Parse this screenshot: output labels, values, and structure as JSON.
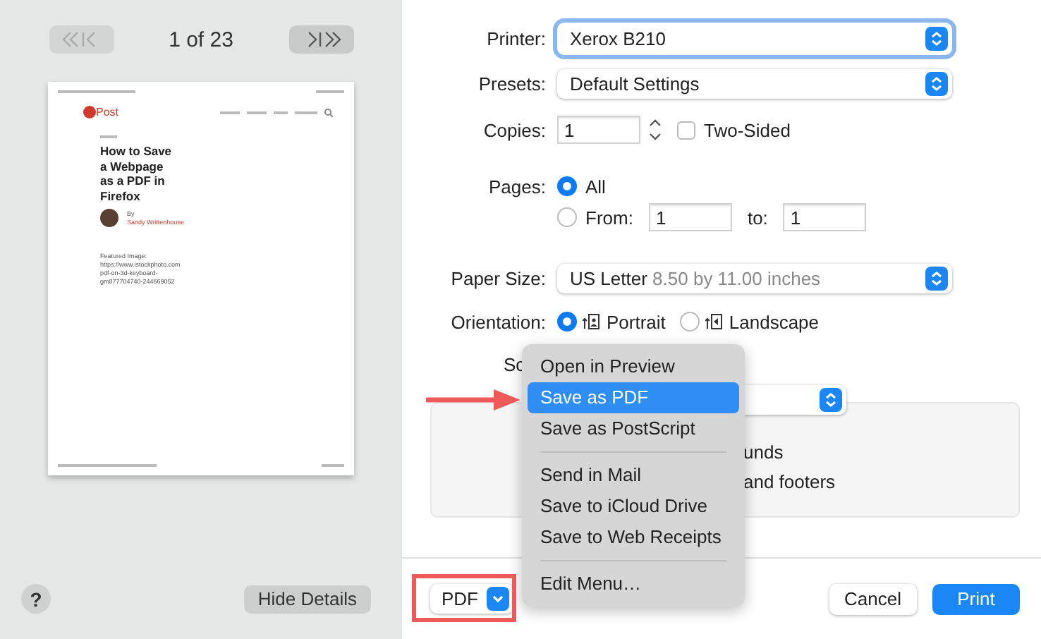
{
  "preview": {
    "page_counter": "1 of 23",
    "page": {
      "logo": "Post",
      "title": "How to Save a Webpage as a PDF in Firefox",
      "byline": "By",
      "author": "Sandy Writtenhouse",
      "featured_image": [
        "Featured Image:",
        "https://www.istockphoto.com",
        "pdf-on-3d-keyboard-",
        "gm877704740-244669052"
      ]
    }
  },
  "help_button": "?",
  "hide_details_button": "Hide Details",
  "settings": {
    "printer": {
      "label": "Printer:",
      "value": "Xerox B210"
    },
    "presets": {
      "label": "Presets:",
      "value": "Default Settings"
    },
    "copies": {
      "label": "Copies:",
      "value": "1",
      "two_sided": {
        "label": "Two-Sided",
        "checked": false
      }
    },
    "pages": {
      "label": "Pages:",
      "options": [
        {
          "label": "All",
          "selected": true
        },
        {
          "label": "From:",
          "selected": false
        }
      ],
      "from": "1",
      "to_label": "to:",
      "to": "1"
    },
    "paper_size": {
      "label": "Paper Size:",
      "value": "US Letter",
      "detail": "8.50 by 11.00 inches"
    },
    "orientation": {
      "label": "Orientation:",
      "options": [
        {
          "label": "Portrait",
          "kind": "portrait",
          "selected": true
        },
        {
          "label": "Landscape",
          "kind": "landscape",
          "selected": false
        }
      ]
    },
    "scale": {
      "label": "Sc"
    },
    "options_box": {
      "lines": [
        "unds",
        "and footers"
      ]
    }
  },
  "pdf_menu": {
    "button": "PDF",
    "groups": [
      [
        {
          "label": "Open in Preview",
          "selected": false
        },
        {
          "label": "Save as PDF",
          "selected": true
        },
        {
          "label": "Save as PostScript",
          "selected": false
        }
      ],
      [
        {
          "label": "Send in Mail",
          "selected": false
        },
        {
          "label": "Save to iCloud Drive",
          "selected": false
        },
        {
          "label": "Save to Web Receipts",
          "selected": false
        }
      ],
      [
        {
          "label": "Edit Menu…",
          "selected": false
        }
      ]
    ]
  },
  "buttons": {
    "cancel": "Cancel",
    "print": "Print"
  }
}
